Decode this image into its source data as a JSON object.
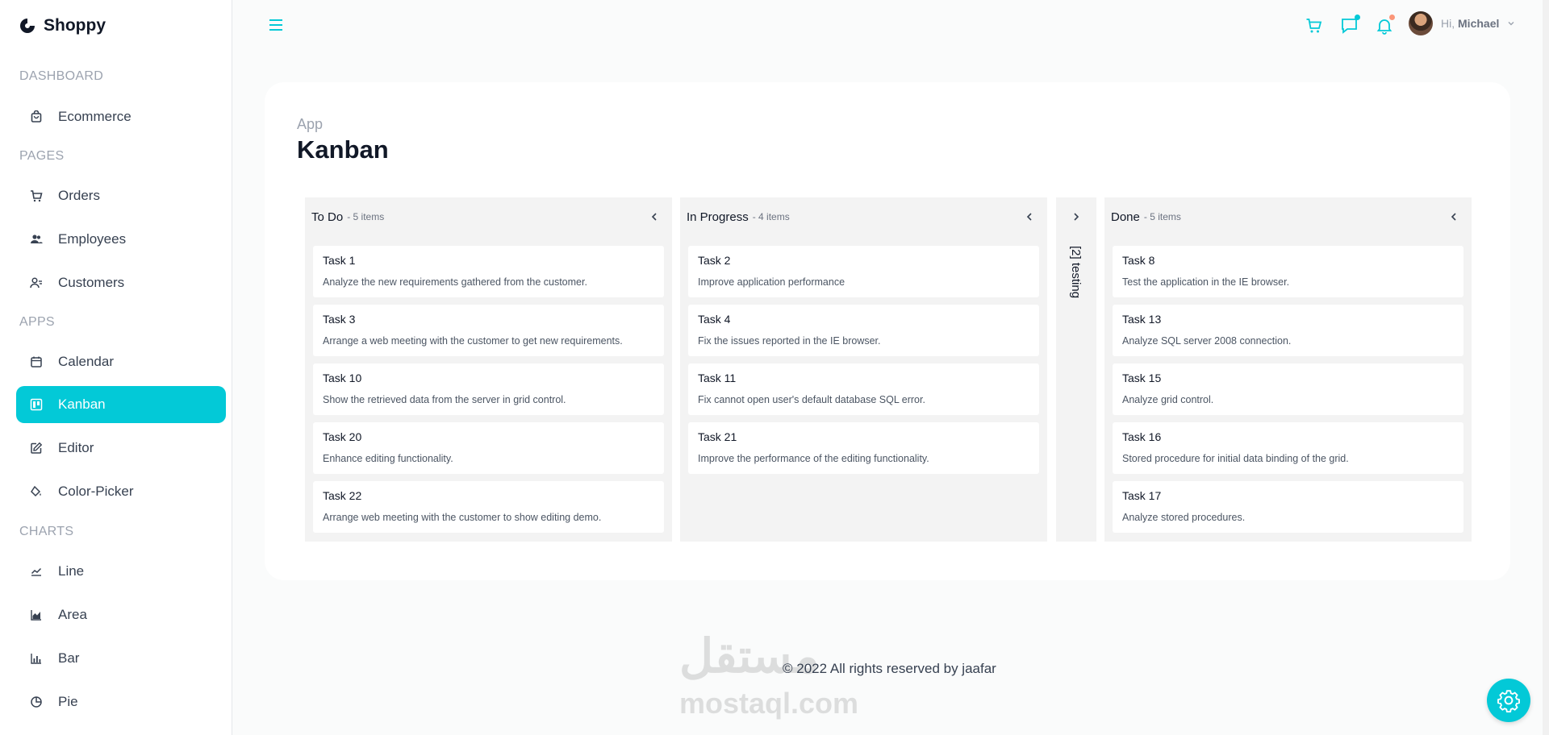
{
  "brand": {
    "name": "Shoppy"
  },
  "sidebar": {
    "sections": [
      {
        "title": "DASHBOARD",
        "items": [
          {
            "label": "Ecommerce",
            "icon": "shopping-bag-icon"
          }
        ]
      },
      {
        "title": "PAGES",
        "items": [
          {
            "label": "Orders",
            "icon": "cart-icon"
          },
          {
            "label": "Employees",
            "icon": "people-icon"
          },
          {
            "label": "Customers",
            "icon": "customer-icon"
          }
        ]
      },
      {
        "title": "APPS",
        "items": [
          {
            "label": "Calendar",
            "icon": "calendar-icon"
          },
          {
            "label": "Kanban",
            "icon": "kanban-icon",
            "active": true
          },
          {
            "label": "Editor",
            "icon": "edit-icon"
          },
          {
            "label": "Color-Picker",
            "icon": "color-bucket-icon"
          }
        ]
      },
      {
        "title": "CHARTS",
        "items": [
          {
            "label": "Line",
            "icon": "line-chart-icon"
          },
          {
            "label": "Area",
            "icon": "area-chart-icon"
          },
          {
            "label": "Bar",
            "icon": "bar-chart-icon"
          },
          {
            "label": "Pie",
            "icon": "pie-chart-icon"
          }
        ]
      }
    ]
  },
  "topbar": {
    "greeting": "Hi,",
    "user_name": "Michael",
    "accent": "#03c9d7",
    "chat_dot_color": "#03c9d7",
    "notification_dot_color": "#fb9678"
  },
  "page": {
    "breadcrumb": "App",
    "title": "Kanban"
  },
  "kanban": {
    "columns": [
      {
        "title": "To Do",
        "count": "- 5 items",
        "cards": [
          {
            "title": "Task 1",
            "desc": "Analyze the new requirements gathered from the customer."
          },
          {
            "title": "Task 3",
            "desc": "Arrange a web meeting with the customer to get new requirements."
          },
          {
            "title": "Task 10",
            "desc": "Show the retrieved data from the server in grid control."
          },
          {
            "title": "Task 20",
            "desc": "Enhance editing functionality."
          },
          {
            "title": "Task 22",
            "desc": "Arrange web meeting with the customer to show editing demo."
          }
        ]
      },
      {
        "title": "In Progress",
        "count": "- 4 items",
        "cards": [
          {
            "title": "Task 2",
            "desc": "Improve application performance"
          },
          {
            "title": "Task 4",
            "desc": "Fix the issues reported in the IE browser."
          },
          {
            "title": "Task 11",
            "desc": "Fix cannot open user's default database SQL error."
          },
          {
            "title": "Task 21",
            "desc": "Improve the performance of the editing functionality."
          }
        ]
      },
      {
        "title": "Done",
        "count": "- 5 items",
        "cards": [
          {
            "title": "Task 8",
            "desc": "Test the application in the IE browser."
          },
          {
            "title": "Task 13",
            "desc": "Analyze SQL server 2008 connection."
          },
          {
            "title": "Task 15",
            "desc": "Analyze grid control."
          },
          {
            "title": "Task 16",
            "desc": "Stored procedure for initial data binding of the grid."
          },
          {
            "title": "Task 17",
            "desc": "Analyze stored procedures."
          }
        ]
      }
    ],
    "collapsed_column": {
      "label": "[2] testing"
    }
  },
  "footer": {
    "text": "© 2022 All rights reserved by jaafar"
  },
  "watermark": {
    "arabic": "مستقل",
    "latin": "mostaql.com"
  }
}
